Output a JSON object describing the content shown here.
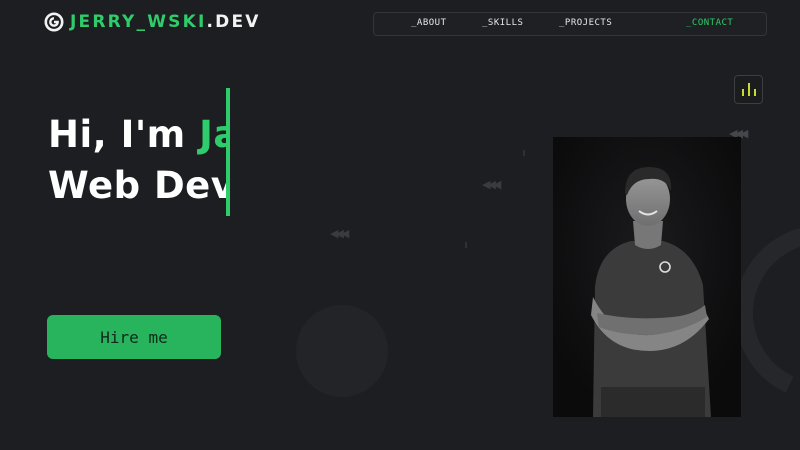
{
  "header": {
    "logo_green": "JERRY_WSKI",
    "logo_white": ".DEV",
    "logo_icon": "g-logo-icon",
    "nav": [
      {
        "label": "_ABOUT",
        "active": false
      },
      {
        "label": "_SKILLS",
        "active": false
      },
      {
        "label": "_PROJECTS",
        "active": false
      },
      {
        "label": "_CONTACT",
        "active": true
      }
    ]
  },
  "hero": {
    "line1_prefix": "Hi, I'm ",
    "line1_highlight": "Ja",
    "line2": "Web Dev",
    "cta_label": "Hire me"
  },
  "audio_toggle": {
    "icon": "sound-bars-icon"
  },
  "colors": {
    "background": "#1d1e21",
    "accent": "#2ecc6a",
    "button": "#27b45c",
    "audio_bars": "#c6dc32"
  }
}
